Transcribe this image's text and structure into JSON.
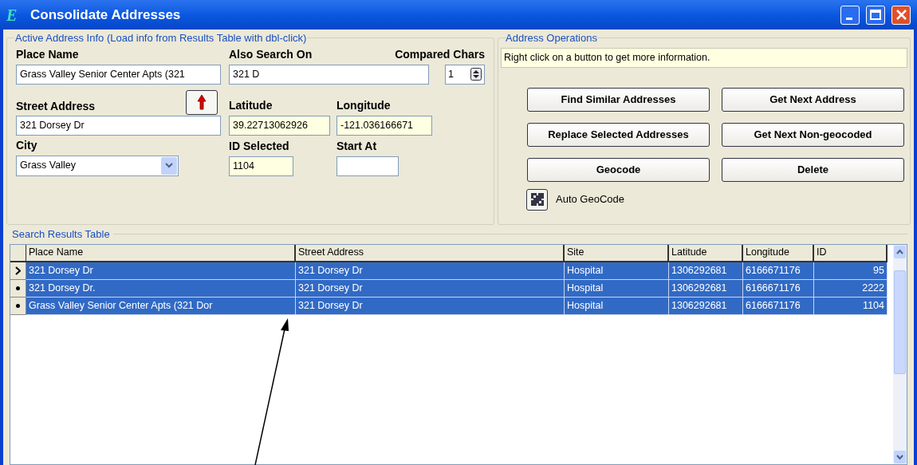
{
  "window": {
    "title": "Consolidate Addresses",
    "app_icon_letter": "E"
  },
  "active_address": {
    "legend": "Active Address Info (Load info from Results Table with dbl-click)",
    "place_name": {
      "label": "Place Name",
      "value": "Grass Valley Senior Center Apts (321"
    },
    "also_search_on": {
      "label": "Also Search On",
      "value": "321 D"
    },
    "compared_chars": {
      "label": "Compared Chars",
      "value": "1"
    },
    "street_address": {
      "label": "Street Address",
      "value": "321 Dorsey Dr"
    },
    "latitude": {
      "label": "Latitude",
      "value": "39.22713062926"
    },
    "longitude": {
      "label": "Longitude",
      "value": "-121.036166671"
    },
    "city": {
      "label": "City",
      "value": "Grass Valley"
    },
    "id_selected": {
      "label": "ID Selected",
      "value": "1104"
    },
    "start_at": {
      "label": "Start At"
    }
  },
  "address_operations": {
    "legend": "Address Operations",
    "info": "Right click on a button to get more information.",
    "buttons": [
      "Find Similar Addresses",
      "Get Next Address",
      "Replace Selected Addresses",
      "Get Next Non-geocoded",
      "Geocode",
      "Delete"
    ],
    "auto_geocode": {
      "label": "Auto GeoCode"
    }
  },
  "results": {
    "legend": "Search Results Table",
    "columns": [
      "Place Name",
      "Street Address",
      "Site",
      "Latitude",
      "Longitude",
      "ID"
    ],
    "rows": [
      {
        "kind": "current",
        "selected": true,
        "cells": [
          "321 Dorsey Dr",
          "321 Dorsey Dr",
          "Hospital",
          "1306292681",
          "6166671176",
          "95"
        ]
      },
      {
        "kind": "dot",
        "selected": true,
        "cells": [
          "321 Dorsey Dr.",
          "321 Dorsey Dr",
          "Hospital",
          "1306292681",
          "6166671176",
          "2222"
        ]
      },
      {
        "kind": "dot",
        "selected": true,
        "cells": [
          "Grass Valley Senior Center Apts (321 Dor",
          "321 Dorsey Dr",
          "Hospital",
          "1306292681",
          "6166671176",
          "1104"
        ]
      }
    ]
  }
}
